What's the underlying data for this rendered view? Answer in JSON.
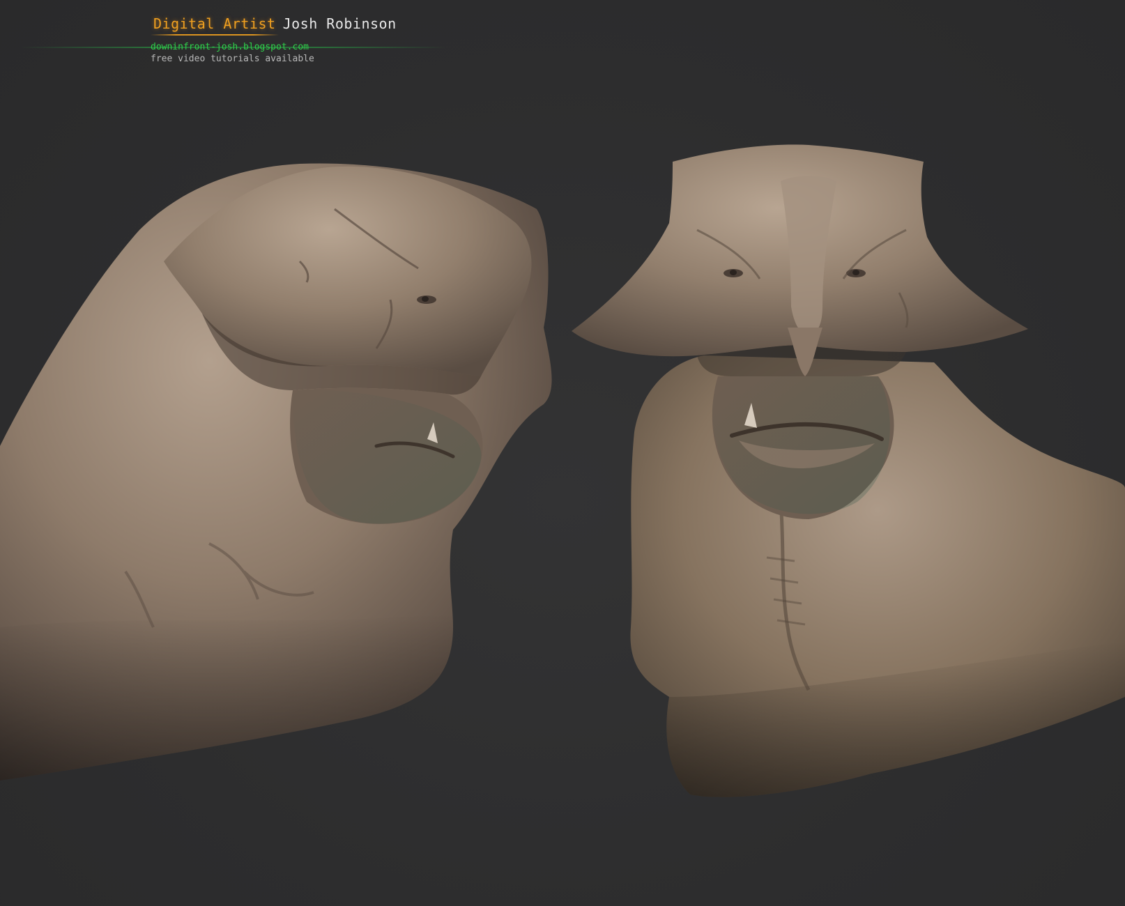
{
  "header": {
    "role": "Digital Artist",
    "name": "Josh Robinson",
    "url": "downinfront-josh.blogspot.com",
    "tagline": "free video tutorials available"
  },
  "colors": {
    "background": "#2e2e2f",
    "role_text": "#f0a020",
    "name_text": "#e8e8e8",
    "url_text": "#2fd04a",
    "tagline_text": "#b8b8b8",
    "clay_light": "#a08c7a",
    "clay_mid": "#7e6c5c",
    "clay_dark": "#4a3f36"
  },
  "artwork": {
    "subject": "two clay-render views of a creature bust",
    "views": [
      "three-quarter-view",
      "front-view"
    ]
  }
}
